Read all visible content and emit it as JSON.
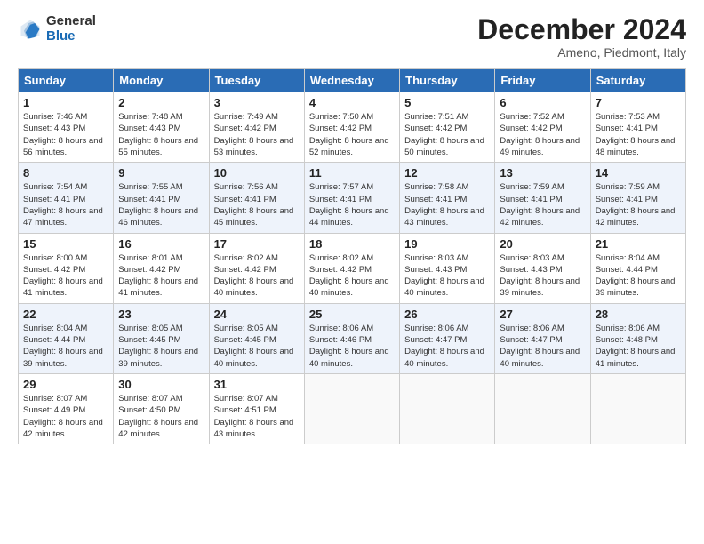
{
  "logo": {
    "general": "General",
    "blue": "Blue"
  },
  "title": "December 2024",
  "subtitle": "Ameno, Piedmont, Italy",
  "days": [
    "Sunday",
    "Monday",
    "Tuesday",
    "Wednesday",
    "Thursday",
    "Friday",
    "Saturday"
  ],
  "weeks": [
    [
      {
        "day": "1",
        "sunrise": "7:46 AM",
        "sunset": "4:43 PM",
        "daylight": "8 hours and 56 minutes."
      },
      {
        "day": "2",
        "sunrise": "7:48 AM",
        "sunset": "4:43 PM",
        "daylight": "8 hours and 55 minutes."
      },
      {
        "day": "3",
        "sunrise": "7:49 AM",
        "sunset": "4:42 PM",
        "daylight": "8 hours and 53 minutes."
      },
      {
        "day": "4",
        "sunrise": "7:50 AM",
        "sunset": "4:42 PM",
        "daylight": "8 hours and 52 minutes."
      },
      {
        "day": "5",
        "sunrise": "7:51 AM",
        "sunset": "4:42 PM",
        "daylight": "8 hours and 50 minutes."
      },
      {
        "day": "6",
        "sunrise": "7:52 AM",
        "sunset": "4:42 PM",
        "daylight": "8 hours and 49 minutes."
      },
      {
        "day": "7",
        "sunrise": "7:53 AM",
        "sunset": "4:41 PM",
        "daylight": "8 hours and 48 minutes."
      }
    ],
    [
      {
        "day": "8",
        "sunrise": "7:54 AM",
        "sunset": "4:41 PM",
        "daylight": "8 hours and 47 minutes."
      },
      {
        "day": "9",
        "sunrise": "7:55 AM",
        "sunset": "4:41 PM",
        "daylight": "8 hours and 46 minutes."
      },
      {
        "day": "10",
        "sunrise": "7:56 AM",
        "sunset": "4:41 PM",
        "daylight": "8 hours and 45 minutes."
      },
      {
        "day": "11",
        "sunrise": "7:57 AM",
        "sunset": "4:41 PM",
        "daylight": "8 hours and 44 minutes."
      },
      {
        "day": "12",
        "sunrise": "7:58 AM",
        "sunset": "4:41 PM",
        "daylight": "8 hours and 43 minutes."
      },
      {
        "day": "13",
        "sunrise": "7:59 AM",
        "sunset": "4:41 PM",
        "daylight": "8 hours and 42 minutes."
      },
      {
        "day": "14",
        "sunrise": "7:59 AM",
        "sunset": "4:41 PM",
        "daylight": "8 hours and 42 minutes."
      }
    ],
    [
      {
        "day": "15",
        "sunrise": "8:00 AM",
        "sunset": "4:42 PM",
        "daylight": "8 hours and 41 minutes."
      },
      {
        "day": "16",
        "sunrise": "8:01 AM",
        "sunset": "4:42 PM",
        "daylight": "8 hours and 41 minutes."
      },
      {
        "day": "17",
        "sunrise": "8:02 AM",
        "sunset": "4:42 PM",
        "daylight": "8 hours and 40 minutes."
      },
      {
        "day": "18",
        "sunrise": "8:02 AM",
        "sunset": "4:42 PM",
        "daylight": "8 hours and 40 minutes."
      },
      {
        "day": "19",
        "sunrise": "8:03 AM",
        "sunset": "4:43 PM",
        "daylight": "8 hours and 40 minutes."
      },
      {
        "day": "20",
        "sunrise": "8:03 AM",
        "sunset": "4:43 PM",
        "daylight": "8 hours and 39 minutes."
      },
      {
        "day": "21",
        "sunrise": "8:04 AM",
        "sunset": "4:44 PM",
        "daylight": "8 hours and 39 minutes."
      }
    ],
    [
      {
        "day": "22",
        "sunrise": "8:04 AM",
        "sunset": "4:44 PM",
        "daylight": "8 hours and 39 minutes."
      },
      {
        "day": "23",
        "sunrise": "8:05 AM",
        "sunset": "4:45 PM",
        "daylight": "8 hours and 39 minutes."
      },
      {
        "day": "24",
        "sunrise": "8:05 AM",
        "sunset": "4:45 PM",
        "daylight": "8 hours and 40 minutes."
      },
      {
        "day": "25",
        "sunrise": "8:06 AM",
        "sunset": "4:46 PM",
        "daylight": "8 hours and 40 minutes."
      },
      {
        "day": "26",
        "sunrise": "8:06 AM",
        "sunset": "4:47 PM",
        "daylight": "8 hours and 40 minutes."
      },
      {
        "day": "27",
        "sunrise": "8:06 AM",
        "sunset": "4:47 PM",
        "daylight": "8 hours and 40 minutes."
      },
      {
        "day": "28",
        "sunrise": "8:06 AM",
        "sunset": "4:48 PM",
        "daylight": "8 hours and 41 minutes."
      }
    ],
    [
      {
        "day": "29",
        "sunrise": "8:07 AM",
        "sunset": "4:49 PM",
        "daylight": "8 hours and 42 minutes."
      },
      {
        "day": "30",
        "sunrise": "8:07 AM",
        "sunset": "4:50 PM",
        "daylight": "8 hours and 42 minutes."
      },
      {
        "day": "31",
        "sunrise": "8:07 AM",
        "sunset": "4:51 PM",
        "daylight": "8 hours and 43 minutes."
      },
      null,
      null,
      null,
      null
    ]
  ],
  "labels": {
    "sunrise_prefix": "Sunrise: ",
    "sunset_prefix": "Sunset: ",
    "daylight_prefix": "Daylight: "
  }
}
